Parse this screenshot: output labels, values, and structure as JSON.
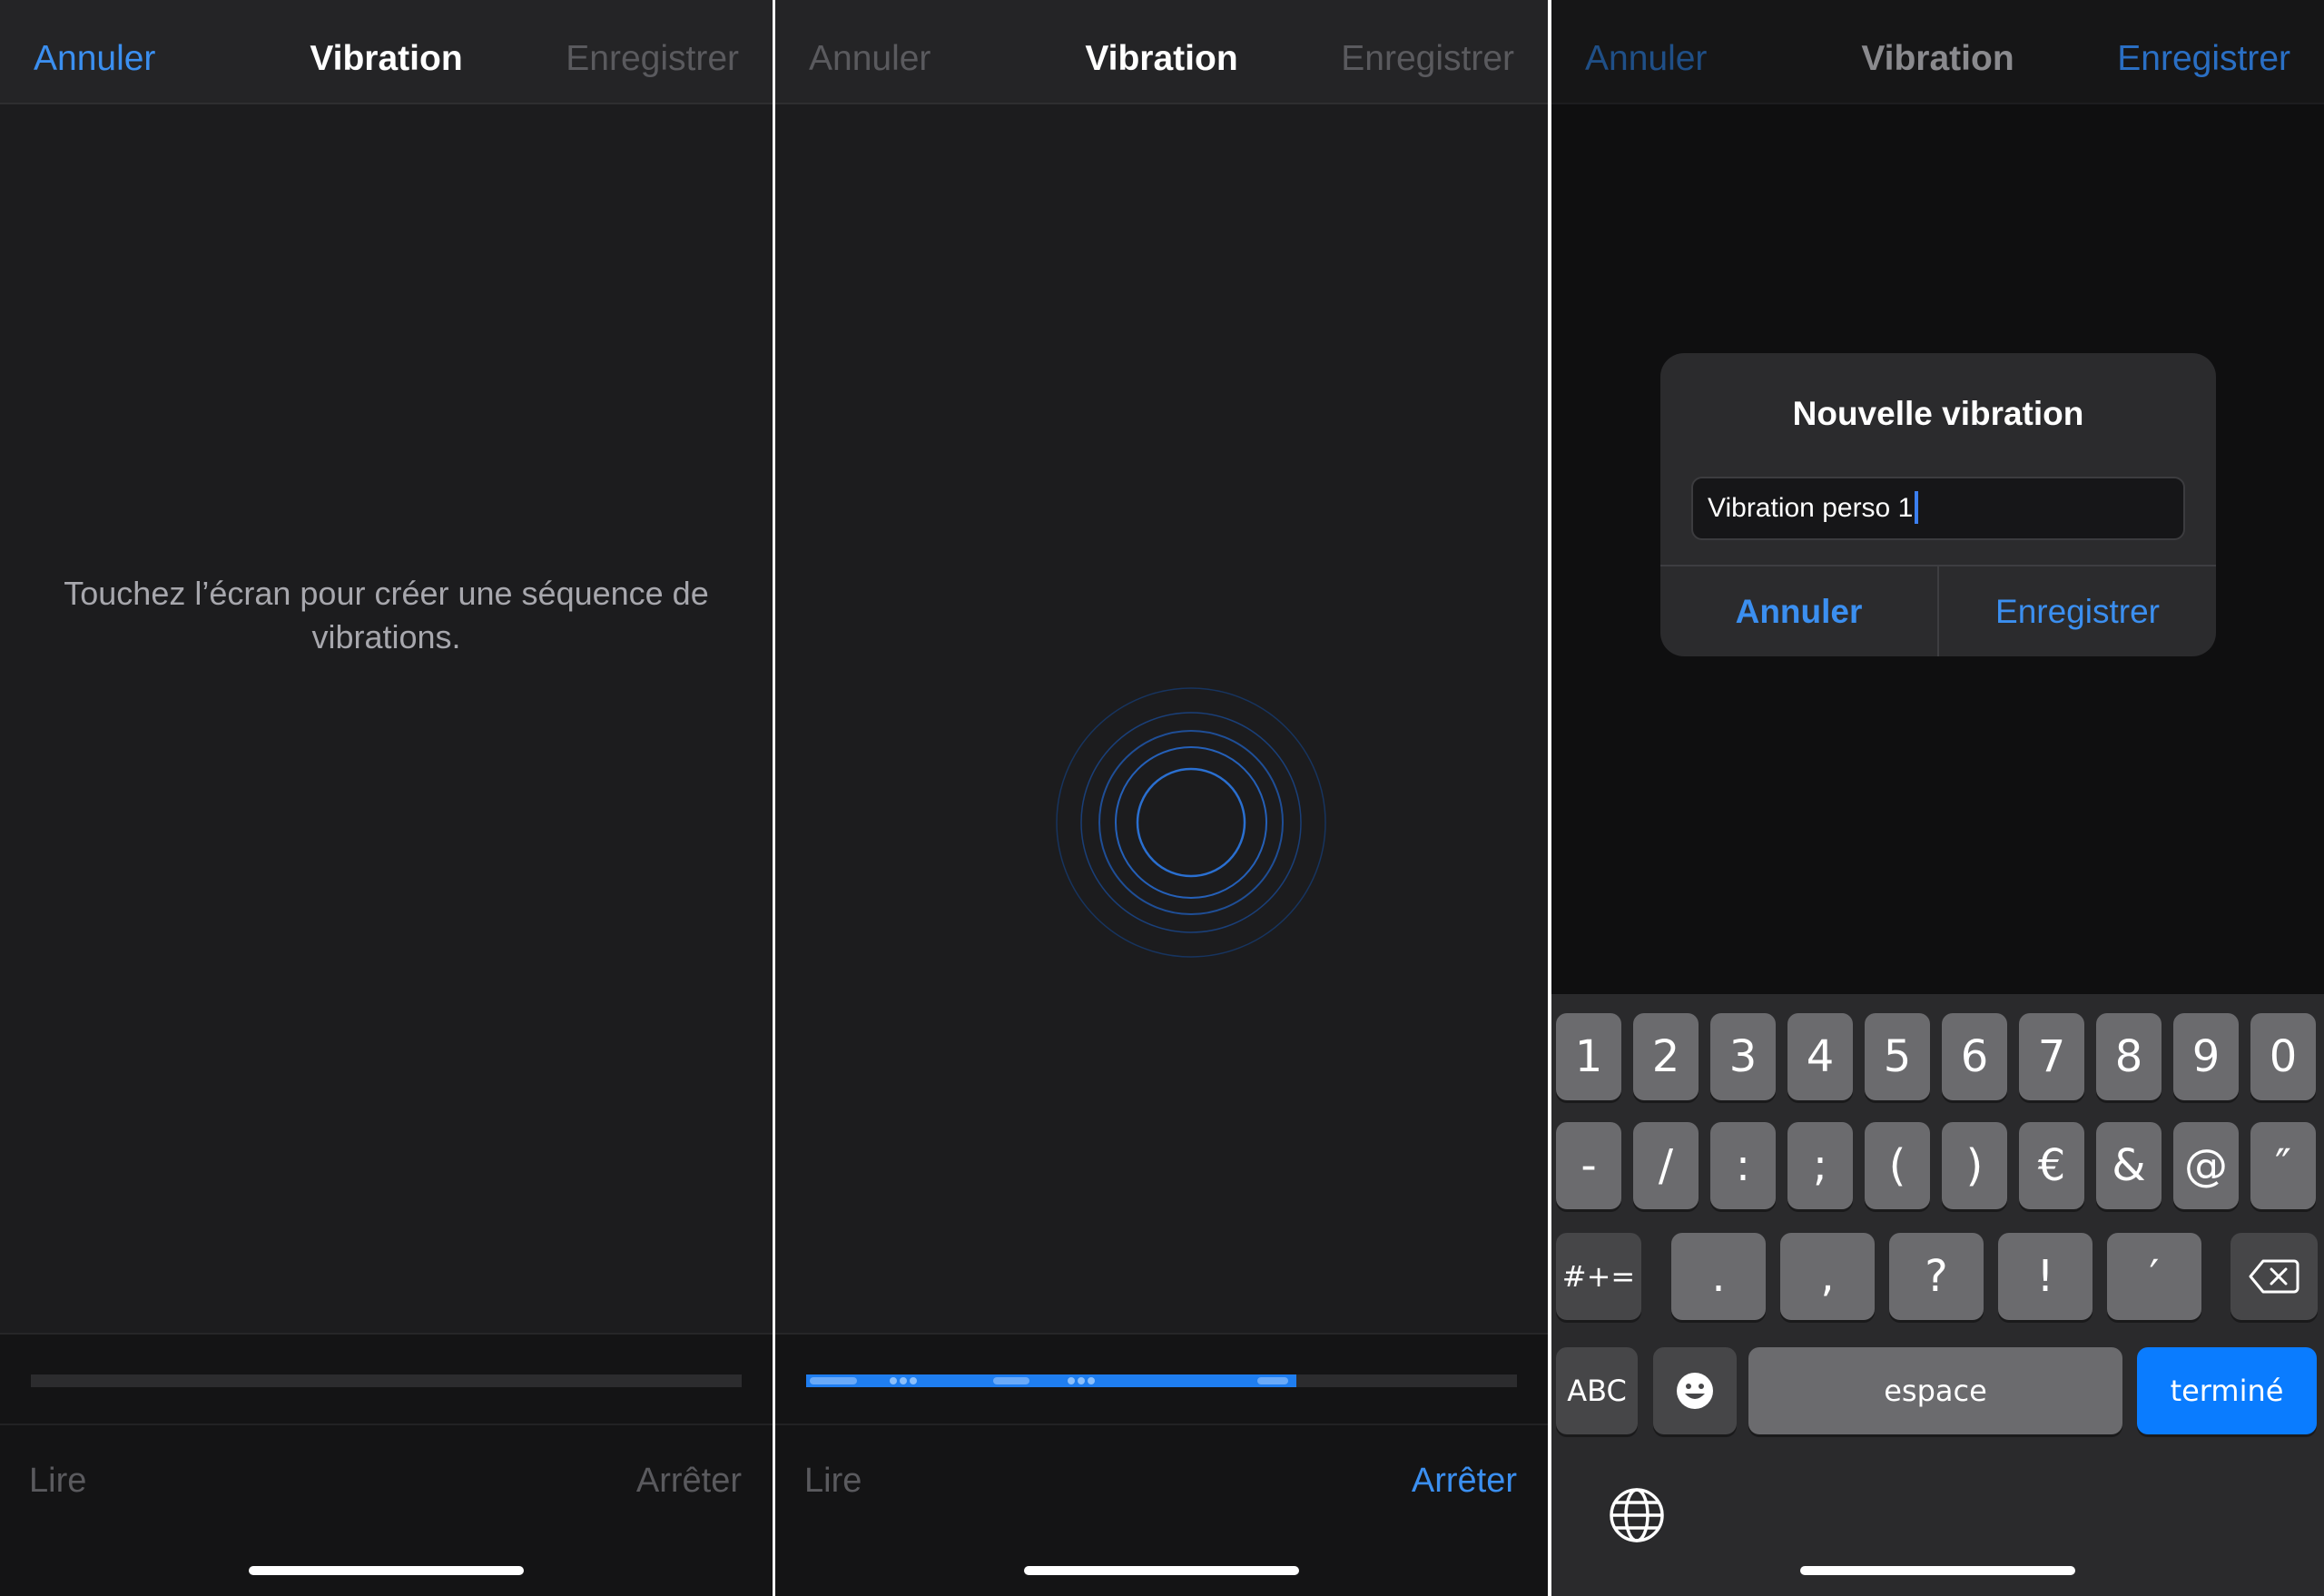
{
  "panel1": {
    "nav": {
      "cancel": "Annuler",
      "title": "Vibration",
      "save": "Enregistrer"
    },
    "hint": "Touchez l’écran pour créer une séquence de vibrations.",
    "controls": {
      "play": "Lire",
      "stop": "Arrêter"
    }
  },
  "panel2": {
    "nav": {
      "cancel": "Annuler",
      "title": "Vibration",
      "save": "Enregistrer"
    },
    "recording_progress": 0.69,
    "controls": {
      "play": "Lire",
      "stop": "Arrêter"
    }
  },
  "panel3": {
    "nav": {
      "cancel": "Annuler",
      "title": "Vibration",
      "save": "Enregistrer"
    },
    "dialog": {
      "title": "Nouvelle vibration",
      "input_value": "Vibration perso 1",
      "cancel": "Annuler",
      "save": "Enregistrer"
    },
    "keyboard": {
      "row1": [
        "1",
        "2",
        "3",
        "4",
        "5",
        "6",
        "7",
        "8",
        "9",
        "0"
      ],
      "row2": [
        "-",
        "/",
        ":",
        ";",
        "(",
        ")",
        "€",
        "&",
        "@",
        "″"
      ],
      "row3": {
        "shift": "#+=",
        "keys": [
          ".",
          ",",
          "?",
          "!",
          "′"
        ],
        "delete_icon": "backspace-icon"
      },
      "row4": {
        "abc": "ABC",
        "emoji_icon": "emoji-icon",
        "space": "espace",
        "done": "terminé"
      },
      "globe_icon": "globe-icon"
    }
  },
  "colors": {
    "accent": "#3b8ff0",
    "done_key": "#0a7cff",
    "background": "#1c1c1e"
  }
}
